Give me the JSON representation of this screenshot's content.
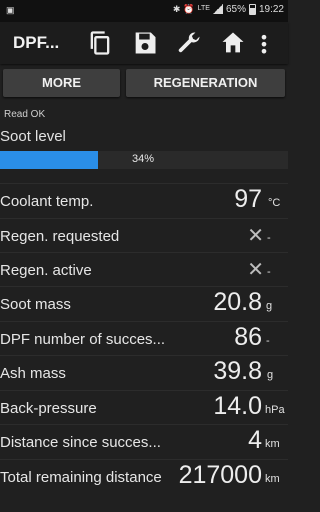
{
  "status": {
    "time": "19:22",
    "battery": "65%",
    "network": "LTE"
  },
  "appbar": {
    "title": "DPF..."
  },
  "buttons": {
    "more": "MORE",
    "regeneration": "REGENERATION"
  },
  "read_status": "Read OK",
  "soot": {
    "label": "Soot level",
    "percent_text": "34%",
    "percent": 34
  },
  "rows": [
    {
      "label": "Coolant temp.",
      "value": "97",
      "unit": "°C"
    },
    {
      "label": "Regen. requested",
      "value": "✕",
      "unit": "-"
    },
    {
      "label": "Regen. active",
      "value": "✕",
      "unit": "-"
    },
    {
      "label": "Soot mass",
      "value": "20.8",
      "unit": "g"
    },
    {
      "label": "DPF number of succes...",
      "value": "86",
      "unit": "-"
    },
    {
      "label": "Ash mass",
      "value": "39.8",
      "unit": "g"
    },
    {
      "label": "Back-pressure",
      "value": "14.0",
      "unit": "hPa"
    },
    {
      "label": "Distance since succes...",
      "value": "4",
      "unit": "km"
    },
    {
      "label": "Total remaining distance",
      "value": "217000",
      "unit": "km"
    }
  ],
  "icons": {
    "copy": "copy-icon",
    "save": "save-icon",
    "wrench": "wrench-icon",
    "home": "home-icon",
    "menu": "overflow-menu-icon"
  }
}
